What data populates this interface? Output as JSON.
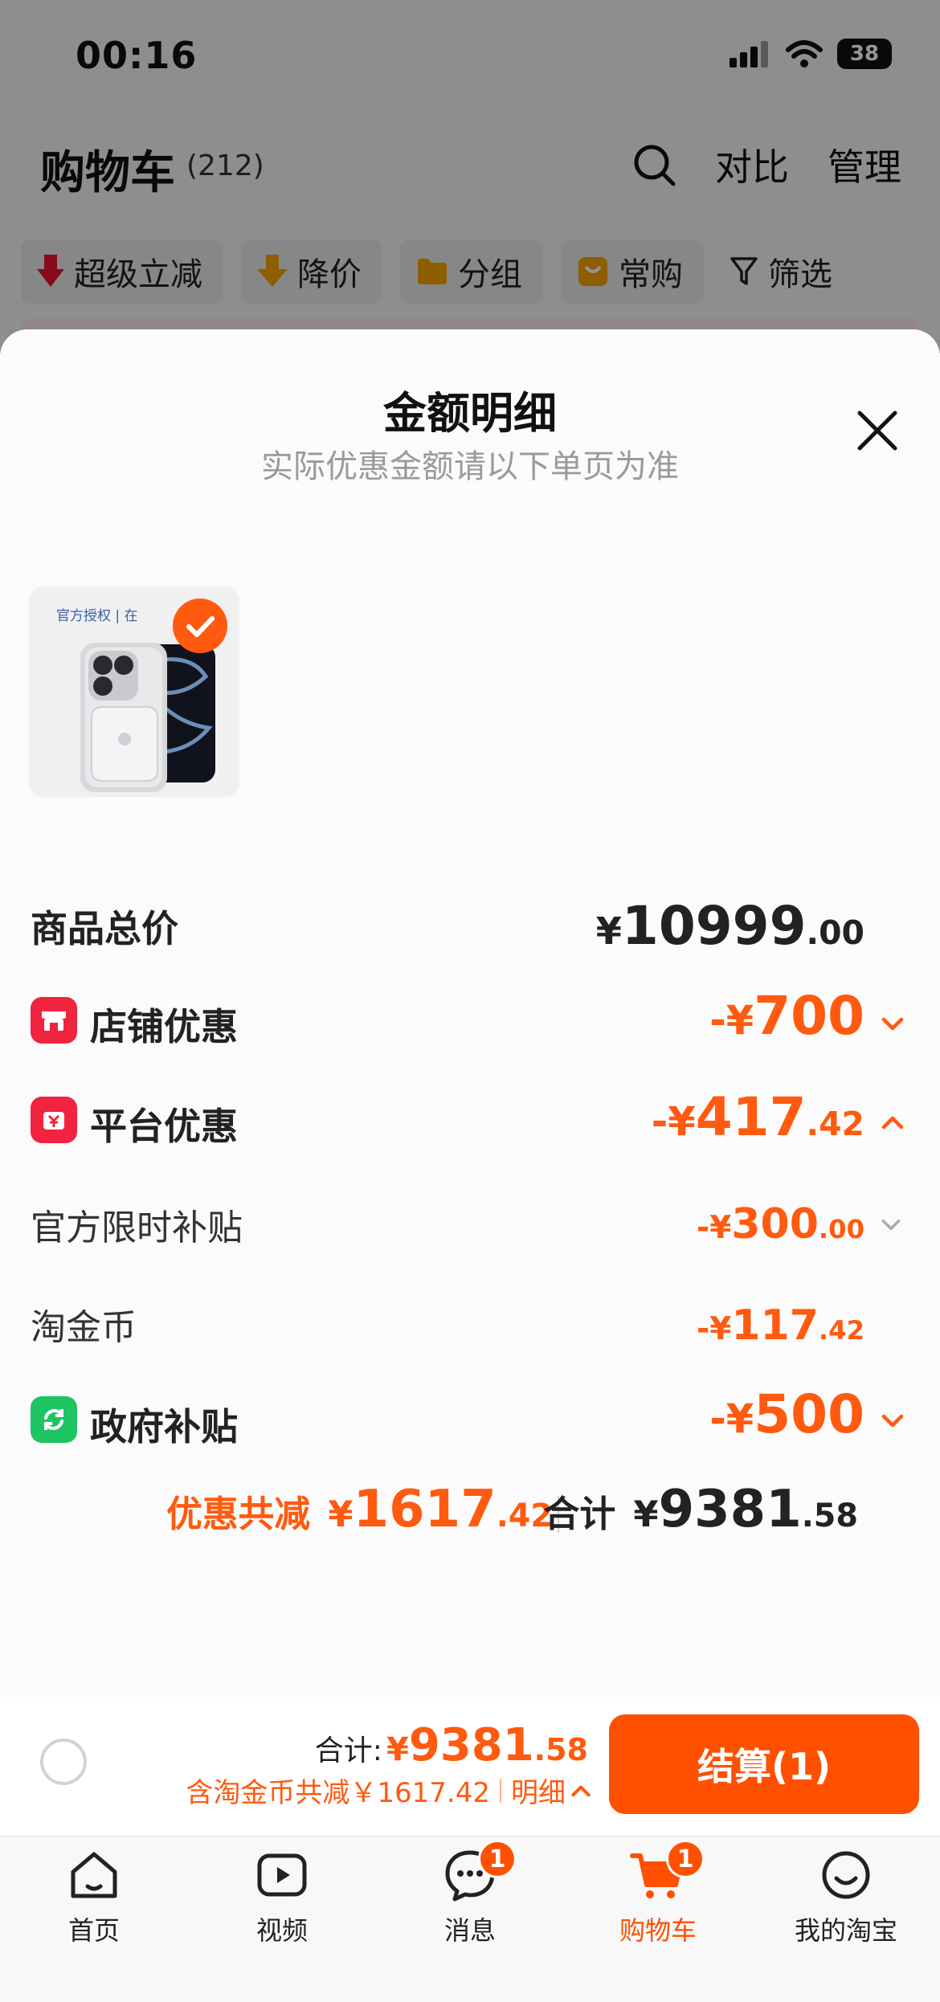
{
  "status_bar": {
    "time": "00:16",
    "battery": "38"
  },
  "header": {
    "title": "购物车",
    "count": "(212)",
    "compare_label": "对比",
    "manage_label": "管理"
  },
  "chips": [
    {
      "label": "超级立减",
      "icon": "down-arrow-red-icon"
    },
    {
      "label": "降价",
      "icon": "down-arrow-yellow-icon"
    },
    {
      "label": "分组",
      "icon": "folder-icon"
    },
    {
      "label": "常购",
      "icon": "bag-icon"
    },
    {
      "label": "筛选",
      "icon": "filter-icon"
    }
  ],
  "sheet": {
    "title": "金额明细",
    "subtitle": "实际优惠金额请以下单页为准",
    "product_thumb_text": "官方授权 | 在",
    "rows": {
      "total": {
        "label": "商品总价",
        "symbol": "¥",
        "int": "10999",
        "dec": ".00"
      },
      "store": {
        "label": "店铺优惠",
        "symbol": "-¥",
        "int": "700",
        "dec": ""
      },
      "platform": {
        "label": "平台优惠",
        "symbol": "-¥",
        "int": "417",
        "dec": ".42"
      },
      "official": {
        "label": "官方限时补贴",
        "symbol": "-¥",
        "int": "300",
        "dec": ".00"
      },
      "coins": {
        "label": "淘金币",
        "symbol": "-¥",
        "int": "117",
        "dec": ".42"
      },
      "gov": {
        "label": "政府补贴",
        "symbol": "-¥",
        "int": "500",
        "dec": ""
      }
    },
    "summary": {
      "discount_label": "优惠共减",
      "discount_symbol": "¥",
      "discount_int": "1617",
      "discount_dec": ".42",
      "total_label": "合计",
      "total_symbol": "¥",
      "total_int": "9381",
      "total_dec": ".58"
    }
  },
  "bottom_bar": {
    "total_label": "合计:",
    "total_symbol": "¥",
    "total_int": "9381",
    "total_dec": ".58",
    "discount_line": "含淘金币共减￥1617.42",
    "detail_label": "明细",
    "checkout_label": "结算(1)"
  },
  "tabs": [
    {
      "label": "首页",
      "icon": "home-icon",
      "active": false
    },
    {
      "label": "视频",
      "icon": "video-icon",
      "active": false
    },
    {
      "label": "消息",
      "icon": "message-icon",
      "active": false,
      "badge": "1"
    },
    {
      "label": "购物车",
      "icon": "cart-icon",
      "active": true,
      "badge": "1"
    },
    {
      "label": "我的淘宝",
      "icon": "profile-icon",
      "active": false
    }
  ],
  "colors": {
    "accent": "#ff5000",
    "discount": "#ff5a0f",
    "store_icon": "#f0243f",
    "gov_icon": "#1fc463"
  }
}
